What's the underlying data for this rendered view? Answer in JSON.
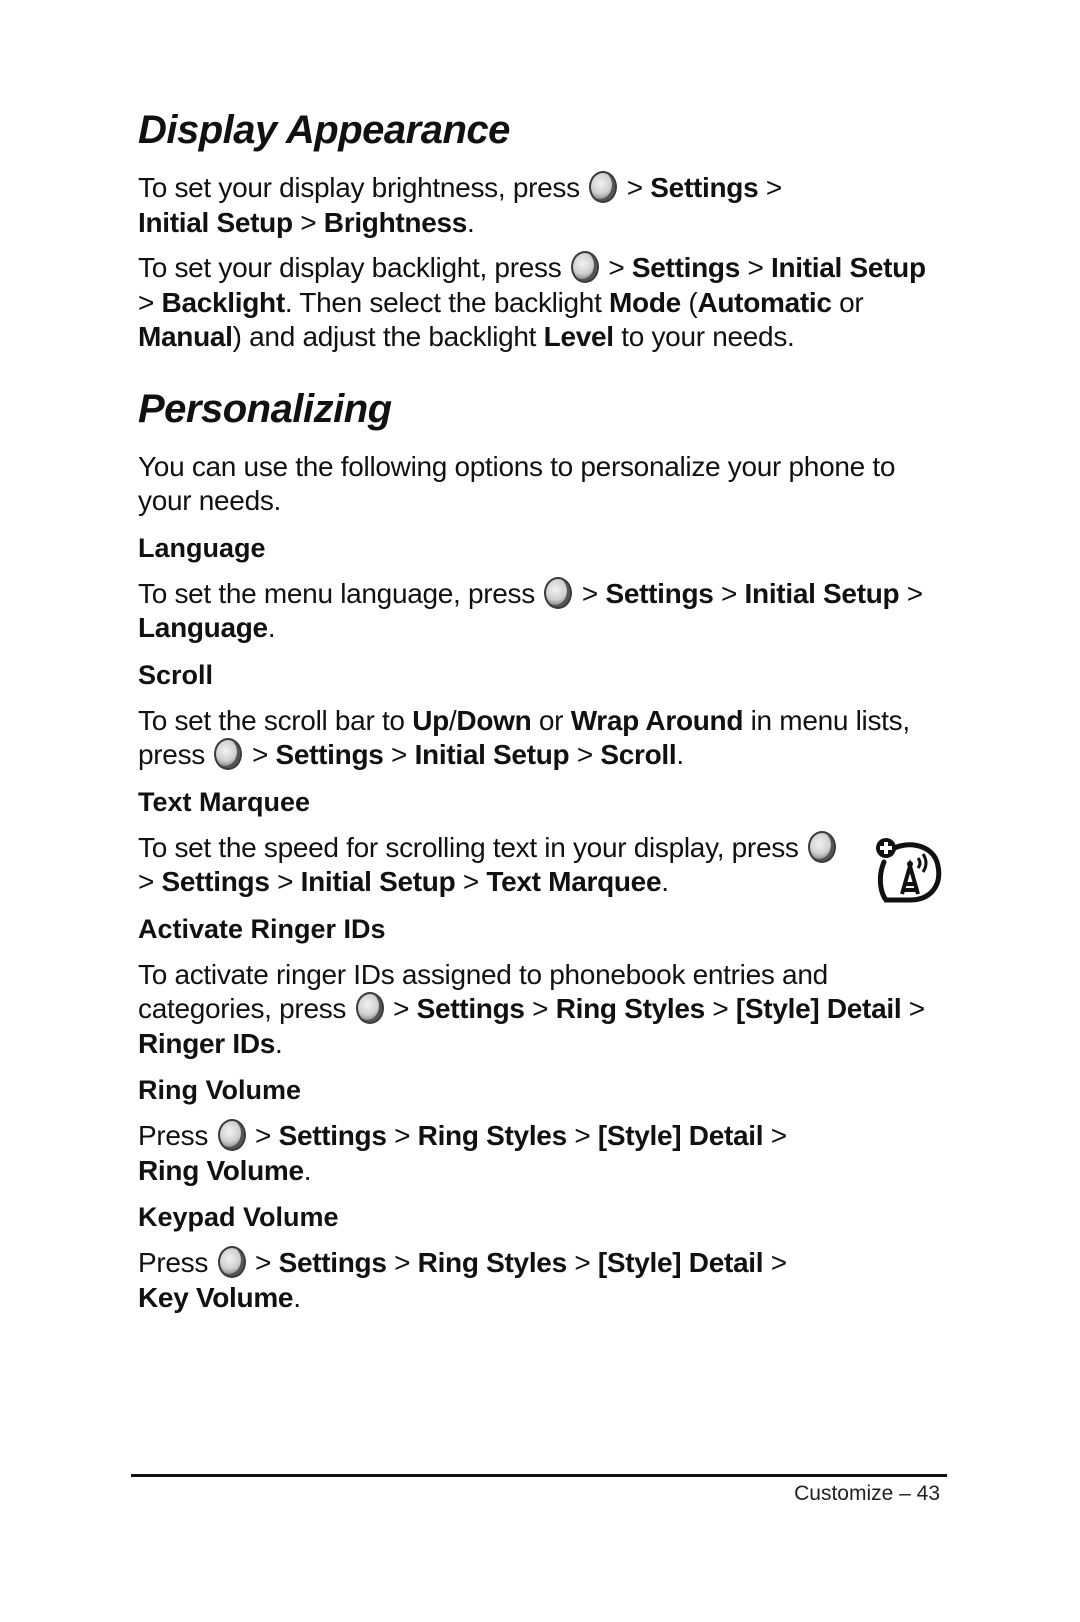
{
  "sections": {
    "display": {
      "title": "Display Appearance",
      "p1": {
        "a": "To set your display brightness, press",
        "b": " > ",
        "c": "Settings",
        "d": " >",
        "e": "Initial Setup",
        "f": " > ",
        "g": "Brightness",
        "h": "."
      },
      "p2": {
        "a": "To set your display backlight, press",
        "b": " > ",
        "c": "Settings",
        "d": " > ",
        "e": "Initial Setup",
        "f": " > ",
        "g": "Backlight",
        "h": ". Then select the backlight ",
        "i": "Mode",
        "j": "(",
        "k": "Automatic",
        "l": " or ",
        "m": "Manual",
        "n": ") and adjust the backlight ",
        "o": "Level",
        "p": " to your needs."
      }
    },
    "personalizing": {
      "title": "Personalizing",
      "intro": "You can use the following options to personalize your phone to your needs.",
      "language": {
        "heading": "Language",
        "a": "To set the menu language, press",
        "c": "Settings",
        "e": "Initial Setup",
        "g": "Language"
      },
      "scroll": {
        "heading": "Scroll",
        "a": "To set the scroll bar to ",
        "b": "Up",
        "c": "/",
        "d": "Down",
        "e": " or ",
        "f": "Wrap Around",
        "g": " in menu lists, press",
        "h": "Settings",
        "i": "Initial Setup",
        "j": "Scroll"
      },
      "marquee": {
        "heading": "Text Marquee",
        "a": "To set the speed for scrolling text in your display, press",
        "c": "Settings",
        "e": "Initial Setup",
        "g": "Text Marquee"
      },
      "ringer_ids": {
        "heading": "Activate Ringer IDs",
        "a": "To activate ringer IDs assigned to phonebook entries and categories, press",
        "c": "Settings",
        "e": "Ring Styles",
        "g": "[Style] Detail",
        "i": "Ringer IDs"
      },
      "ring_volume": {
        "heading": "Ring Volume",
        "a": "Press",
        "c": "Settings",
        "e": "Ring Styles",
        "g": "[Style] Detail",
        "i": "Ring Volume"
      },
      "keypad_volume": {
        "heading": "Keypad Volume",
        "a": "Press",
        "c": "Settings",
        "e": "Ring Styles",
        "g": "[Style] Detail",
        "i": "Key Volume"
      }
    }
  },
  "separators": {
    "gt": " > ",
    "period": "."
  },
  "icons": {
    "menu_key": "menu-key-icon",
    "network_feature": "network-subscription-feature-icon"
  },
  "footer": {
    "text": "Customize – 43"
  }
}
